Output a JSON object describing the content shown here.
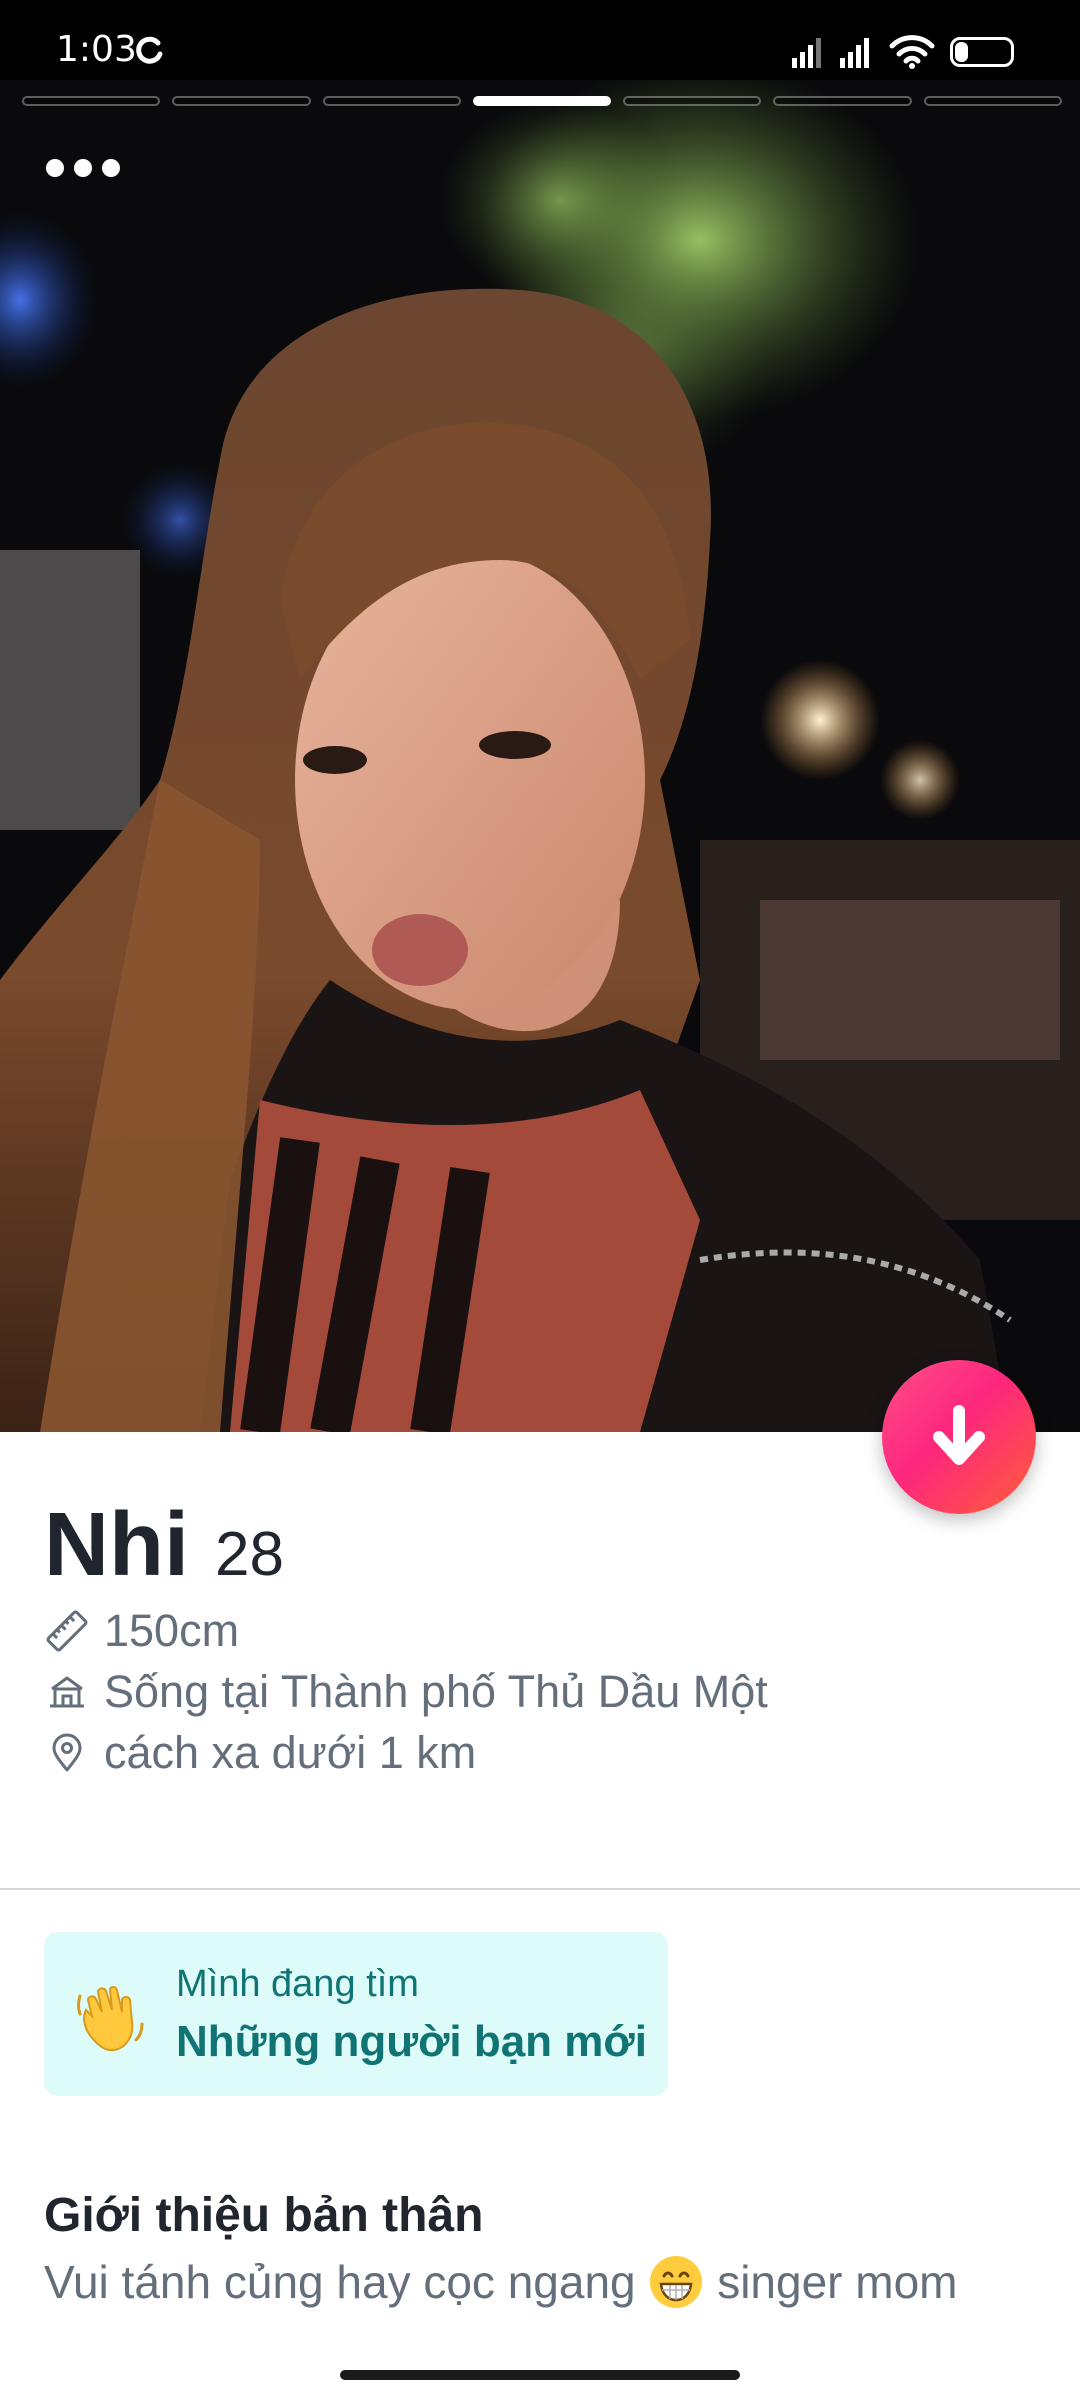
{
  "status_bar": {
    "time": "1:03",
    "battery_level": "24",
    "battery_fraction": 0.24
  },
  "photo": {
    "segments_total": 7,
    "active_segment_index": 3
  },
  "profile": {
    "name": "Nhi",
    "age": "28",
    "height": "150cm",
    "lives_in": "Sống tại Thành phố Thủ Dầu Một",
    "distance": "cách xa dưới 1 km"
  },
  "looking_for": {
    "label": "Mình đang tìm",
    "value": "Những người bạn mới",
    "icon": "waving-hand-icon"
  },
  "about": {
    "title": "Giới thiệu bản thân",
    "text_before_emoji": "Vui tánh củng hay cọc ngang ",
    "text_after_emoji": " singer mom",
    "emoji": "grinning-face-icon"
  },
  "colors": {
    "accent_gradient_start": "#ff4f88",
    "accent_gradient_end": "#ff6036",
    "looking_card_bg": "#ddfbf8",
    "looking_text": "#107474",
    "primary_text": "#21262e",
    "secondary_text": "#656e7b"
  }
}
